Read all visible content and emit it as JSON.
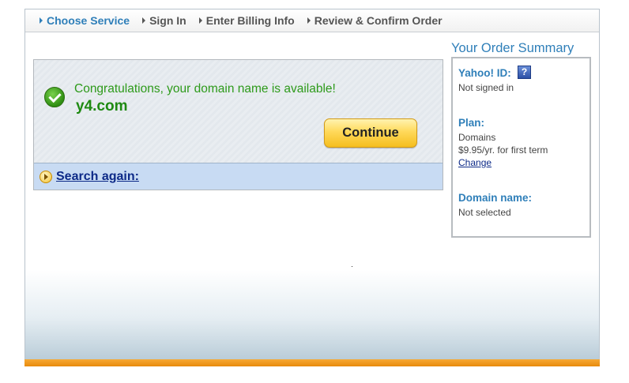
{
  "steps": [
    {
      "label": "Choose Service",
      "active": true
    },
    {
      "label": "Sign In",
      "active": false
    },
    {
      "label": "Enter Billing Info",
      "active": false
    },
    {
      "label": "Review & Confirm Order",
      "active": false
    }
  ],
  "availability": {
    "message": "Congratulations, your domain name is available!",
    "domain": "y4.com",
    "continue_label": "Continue",
    "search_again_label": "Search again:"
  },
  "summary": {
    "title": "Your Order Summary",
    "yahoo_id_label": "Yahoo! ID:",
    "help_glyph": "?",
    "yahoo_id_value": "Not signed in",
    "plan_label": "Plan:",
    "plan_name": "Domains",
    "plan_price": "$9.95/yr. for first term",
    "change_label": "Change",
    "domain_label": "Domain name:",
    "domain_value": "Not selected"
  },
  "colors": {
    "accent": "#2f7fb9",
    "success": "#2d9a1a",
    "button": "#f5be1e",
    "bottom_bar": "#f7a934",
    "search_bar": "#c8dbf3"
  },
  "icons": [
    "chevron-right-icon",
    "check-circle-icon",
    "help-icon",
    "play-circle-icon"
  ]
}
